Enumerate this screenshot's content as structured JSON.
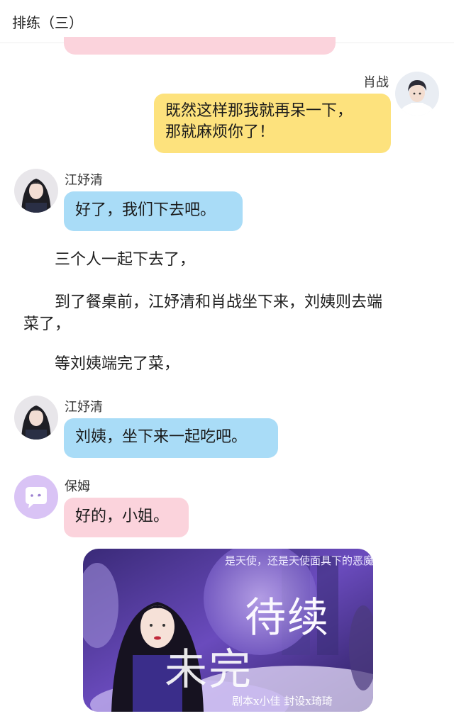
{
  "header": {
    "title": "排练（三）"
  },
  "messages": [
    {
      "speaker": "肖战",
      "text_line1": "既然这样那我就再呆一下，",
      "text_line2": "那就麻烦你了！"
    },
    {
      "speaker": "江妤清",
      "text": "好了，我们下去吧。"
    },
    {
      "speaker": "江妤清",
      "text": "刘姨，坐下来一起吃吧。"
    },
    {
      "speaker": "保姆",
      "text": "好的，小姐。"
    }
  ],
  "narration": [
    "三个人一起下去了，",
    "到了餐桌前，江妤清和肖战坐下来，刘姨则去端",
    "菜了，",
    "等刘姨端完了菜，"
  ],
  "poster": {
    "title1": "待续",
    "title2": "未完",
    "tagline": "是天使，还是天使面具下的恶魔",
    "credits": "剧本x小佳  封设x琦琦"
  },
  "colors": {
    "yellow_bubble": "#fde27d",
    "blue_bubble": "#a9dcf7",
    "pink_bubble": "#fbd3dc",
    "nanny_avatar": "#d9c3f5"
  }
}
